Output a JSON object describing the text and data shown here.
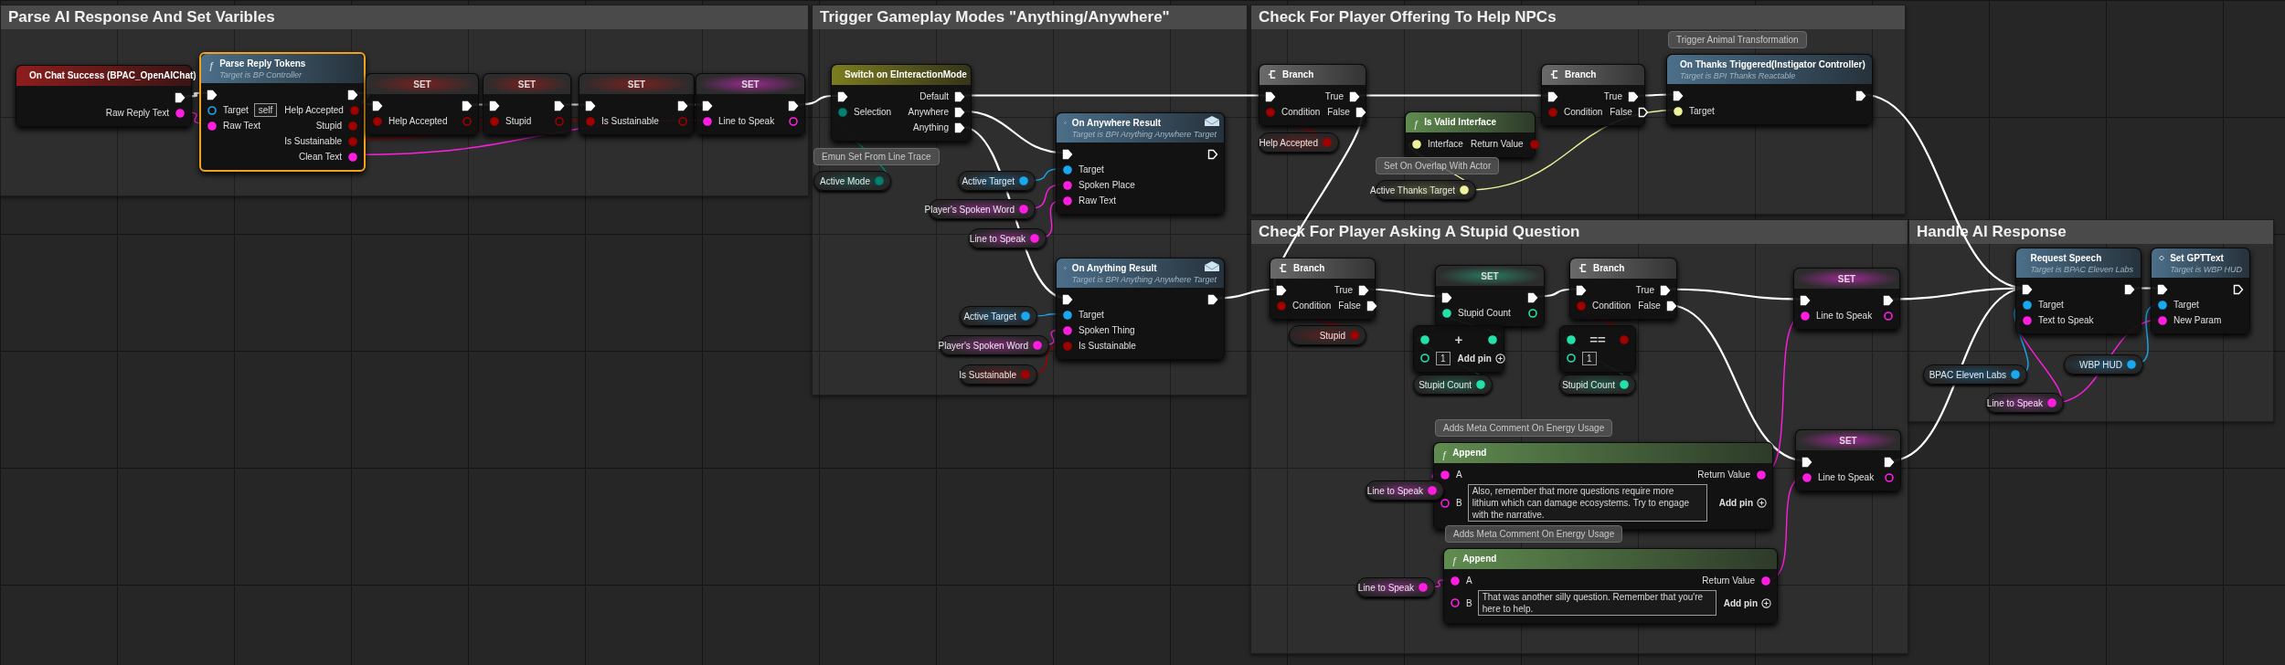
{
  "comments": [
    {
      "title": "Parse AI Response And Set Varibles"
    },
    {
      "title": "Trigger Gameplay Modes \"Anything/Anywhere\""
    },
    {
      "title": "Check For Player Offering To Help NPCs"
    },
    {
      "title": "Check For Player Asking A Stupid Question"
    },
    {
      "title": "Handle AI Response"
    }
  ],
  "nodes": [
    {
      "kind": "event",
      "title": "On Chat Success (BPAC_OpenAIChat)",
      "selected": false,
      "outputs": [
        {
          "kind": "exec",
          "linked": true
        },
        {
          "label": "Raw Reply Text",
          "kind": "string",
          "linked": true
        }
      ]
    },
    {
      "kind": "function",
      "glyph": "ƒ",
      "title": "Parse Reply Tokens",
      "subtitle": "Target is BP Controller",
      "selected": true,
      "inputs": [
        {
          "kind": "exec",
          "linked": true
        },
        {
          "label": "Target",
          "kind": "object",
          "linked": false,
          "value": "self"
        },
        {
          "label": "Raw Text",
          "kind": "string",
          "linked": true
        }
      ],
      "outputs": [
        {
          "kind": "exec",
          "linked": true
        },
        {
          "label": "Help Accepted",
          "kind": "bool",
          "linked": true
        },
        {
          "label": "Stupid",
          "kind": "bool",
          "linked": true
        },
        {
          "label": "Is Sustainable",
          "kind": "bool",
          "linked": true
        },
        {
          "label": "Clean Text",
          "kind": "string",
          "linked": true
        }
      ]
    },
    {
      "kind": "set",
      "title": "SET",
      "selected": false,
      "inputs": [
        {
          "kind": "exec",
          "linked": true
        },
        {
          "label": "Help Accepted",
          "kind": "bool",
          "linked": true
        }
      ],
      "outputs": [
        {
          "kind": "exec",
          "linked": true
        },
        {
          "kind": "bool",
          "linked": false
        }
      ]
    },
    {
      "kind": "set",
      "title": "SET",
      "selected": false,
      "inputs": [
        {
          "kind": "exec",
          "linked": true
        },
        {
          "label": "Stupid",
          "kind": "bool",
          "linked": true
        }
      ],
      "outputs": [
        {
          "kind": "exec",
          "linked": true
        },
        {
          "kind": "bool",
          "linked": false
        }
      ]
    },
    {
      "kind": "set",
      "title": "SET",
      "selected": false,
      "inputs": [
        {
          "kind": "exec",
          "linked": true
        },
        {
          "label": "Is Sustainable",
          "kind": "bool",
          "linked": true
        }
      ],
      "outputs": [
        {
          "kind": "exec",
          "linked": true
        },
        {
          "kind": "bool",
          "linked": false
        }
      ]
    },
    {
      "kind": "set",
      "title": "SET",
      "selected": false,
      "inputs": [
        {
          "kind": "exec",
          "linked": true
        },
        {
          "label": "Line to Speak",
          "kind": "string",
          "linked": true
        }
      ],
      "outputs": [
        {
          "kind": "exec",
          "linked": true
        },
        {
          "kind": "string",
          "linked": false
        }
      ]
    },
    {
      "kind": "switch",
      "title": "Switch on EInteractionMode",
      "selected": false,
      "inputs": [
        {
          "kind": "exec",
          "linked": true
        },
        {
          "label": "Selection",
          "kind": "enum",
          "linked": true
        }
      ],
      "outputs": [
        {
          "label": "Default",
          "kind": "exec",
          "linked": true
        },
        {
          "label": "Anywhere",
          "kind": "exec",
          "linked": true
        },
        {
          "label": "Anything",
          "kind": "exec",
          "linked": true
        }
      ]
    },
    {
      "kind": "variable",
      "title": "Active Mode",
      "note": "Emun Set From Line Trace",
      "selected": false,
      "outputs": [
        {
          "kind": "enum",
          "linked": true
        }
      ]
    },
    {
      "kind": "message",
      "title": "On Anywhere Result",
      "subtitle": "Target is BPI Anything Anywhere Target",
      "selected": false,
      "inputs": [
        {
          "kind": "exec",
          "linked": true
        },
        {
          "label": "Target",
          "kind": "object",
          "linked": true
        },
        {
          "label": "Spoken Place",
          "kind": "string",
          "linked": true
        },
        {
          "label": "Raw Text",
          "kind": "string",
          "linked": true
        }
      ],
      "outputs": [
        {
          "kind": "exec",
          "linked": false
        }
      ]
    },
    {
      "kind": "variable",
      "title": "Active Target",
      "selected": false,
      "outputs": [
        {
          "kind": "object",
          "linked": true
        }
      ]
    },
    {
      "kind": "variable",
      "title": "Player's Spoken Word",
      "selected": false,
      "outputs": [
        {
          "kind": "string",
          "linked": true
        }
      ]
    },
    {
      "kind": "variable",
      "title": "Line to Speak",
      "selected": false,
      "outputs": [
        {
          "kind": "string",
          "linked": true
        }
      ]
    },
    {
      "kind": "message",
      "title": "On Anything Result",
      "subtitle": "Target is BPI Anything Anywhere Target",
      "selected": false,
      "inputs": [
        {
          "kind": "exec",
          "linked": true
        },
        {
          "label": "Target",
          "kind": "object",
          "linked": true
        },
        {
          "label": "Spoken Thing",
          "kind": "string",
          "linked": true
        },
        {
          "label": "Is Sustainable",
          "kind": "bool",
          "linked": true
        }
      ],
      "outputs": [
        {
          "kind": "exec",
          "linked": true
        }
      ]
    },
    {
      "kind": "variable",
      "title": "Active Target",
      "selected": false,
      "outputs": [
        {
          "kind": "object",
          "linked": true
        }
      ]
    },
    {
      "kind": "variable",
      "title": "Player's Spoken Word",
      "selected": false,
      "outputs": [
        {
          "kind": "string",
          "linked": true
        }
      ]
    },
    {
      "kind": "variable",
      "title": "Is Sustainable",
      "selected": false,
      "outputs": [
        {
          "kind": "bool",
          "linked": true
        }
      ]
    },
    {
      "kind": "branch",
      "title": "Branch",
      "selected": false,
      "inputs": [
        {
          "kind": "exec",
          "linked": true
        },
        {
          "label": "Condition",
          "kind": "bool",
          "linked": true
        }
      ],
      "outputs": [
        {
          "label": "True",
          "kind": "exec",
          "linked": true
        },
        {
          "label": "False",
          "kind": "exec",
          "linked": true
        }
      ]
    },
    {
      "kind": "variable",
      "title": "Help Accepted",
      "selected": false,
      "outputs": [
        {
          "kind": "bool",
          "linked": true
        }
      ]
    },
    {
      "kind": "pure",
      "glyph": "ƒ",
      "title": "Is Valid Interface",
      "selected": false,
      "inputs": [
        {
          "label": "Interface",
          "kind": "interface",
          "linked": true
        }
      ],
      "outputs": [
        {
          "label": "Return Value",
          "kind": "bool",
          "linked": true
        }
      ]
    },
    {
      "kind": "variable",
      "title": "Active Thanks Target",
      "note": "Set On Overlap With Actor",
      "selected": false,
      "outputs": [
        {
          "kind": "interface",
          "linked": true
        }
      ]
    },
    {
      "kind": "branch",
      "title": "Branch",
      "selected": false,
      "inputs": [
        {
          "kind": "exec",
          "linked": true
        },
        {
          "label": "Condition",
          "kind": "bool",
          "linked": true
        }
      ],
      "outputs": [
        {
          "label": "True",
          "kind": "exec",
          "linked": true
        },
        {
          "label": "False",
          "kind": "exec",
          "linked": false
        }
      ]
    },
    {
      "kind": "call",
      "title": "On Thanks Triggered(Instigator Controller)",
      "subtitle": "Target is BPI Thanks Reactable",
      "note": "Trigger Animal Transformation",
      "selected": false,
      "inputs": [
        {
          "kind": "exec",
          "linked": true
        },
        {
          "label": "Target",
          "kind": "interface",
          "linked": true
        }
      ],
      "outputs": [
        {
          "kind": "exec",
          "linked": true
        }
      ]
    },
    {
      "kind": "branch",
      "title": "Branch",
      "selected": false,
      "inputs": [
        {
          "kind": "exec",
          "linked": true
        },
        {
          "label": "Condition",
          "kind": "bool",
          "linked": true
        }
      ],
      "outputs": [
        {
          "label": "True",
          "kind": "exec",
          "linked": true
        },
        {
          "label": "False",
          "kind": "exec",
          "linked": true
        }
      ]
    },
    {
      "kind": "variable",
      "title": "Stupid",
      "selected": false,
      "outputs": [
        {
          "kind": "bool",
          "linked": true
        }
      ]
    },
    {
      "kind": "set",
      "title": "SET",
      "selected": false,
      "inputs": [
        {
          "kind": "exec",
          "linked": true
        },
        {
          "label": "Stupid Count",
          "kind": "int",
          "linked": true
        }
      ],
      "outputs": [
        {
          "kind": "exec",
          "linked": true
        },
        {
          "kind": "int",
          "linked": false
        }
      ]
    },
    {
      "kind": "math",
      "op": "+",
      "add_pin": "Add pin",
      "selected": false,
      "inputs": [
        {
          "kind": "int",
          "linked": true
        },
        {
          "kind": "int",
          "linked": false,
          "value": "1"
        }
      ],
      "outputs": [
        {
          "kind": "int",
          "linked": true
        }
      ]
    },
    {
      "kind": "variable",
      "title": "Stupid Count",
      "selected": false,
      "outputs": [
        {
          "kind": "int",
          "linked": true
        }
      ]
    },
    {
      "kind": "branch",
      "title": "Branch",
      "selected": false,
      "inputs": [
        {
          "kind": "exec",
          "linked": true
        },
        {
          "label": "Condition",
          "kind": "bool",
          "linked": true
        }
      ],
      "outputs": [
        {
          "label": "True",
          "kind": "exec",
          "linked": true
        },
        {
          "label": "False",
          "kind": "exec",
          "linked": true
        }
      ]
    },
    {
      "kind": "math",
      "op": "==",
      "selected": false,
      "inputs": [
        {
          "kind": "int",
          "linked": true
        },
        {
          "kind": "int",
          "linked": false,
          "value": "1"
        }
      ],
      "outputs": [
        {
          "kind": "bool",
          "linked": true
        }
      ]
    },
    {
      "kind": "variable",
      "title": "Stupid Count",
      "selected": false,
      "outputs": [
        {
          "kind": "int",
          "linked": true
        }
      ]
    },
    {
      "kind": "pure",
      "glyph": "ƒ",
      "title": "Append",
      "note": "Adds Meta Comment On Energy Usage",
      "add_pin": "Add pin",
      "selected": false,
      "inputs": [
        {
          "label": "A",
          "kind": "string",
          "linked": true
        },
        {
          "label": "B",
          "kind": "string",
          "linked": false,
          "value": "Also, remember that more questions require more lithium which can damage ecosystems. Try to engage with the narrative."
        }
      ],
      "outputs": [
        {
          "label": "Return Value",
          "kind": "string",
          "linked": true
        }
      ]
    },
    {
      "kind": "variable",
      "title": "Line to Speak",
      "selected": false,
      "outputs": [
        {
          "kind": "string",
          "linked": true
        }
      ]
    },
    {
      "kind": "pure",
      "glyph": "ƒ",
      "title": "Append",
      "note": "Adds Meta Comment On Energy Usage",
      "add_pin": "Add pin",
      "selected": false,
      "inputs": [
        {
          "label": "A",
          "kind": "string",
          "linked": true
        },
        {
          "label": "B",
          "kind": "string",
          "linked": false,
          "value": "That was another silly question. Remember that you're here to help."
        }
      ],
      "outputs": [
        {
          "label": "Return Value",
          "kind": "string",
          "linked": true
        }
      ]
    },
    {
      "kind": "variable",
      "title": "Line to Speak",
      "selected": false,
      "outputs": [
        {
          "kind": "string",
          "linked": true
        }
      ]
    },
    {
      "kind": "set",
      "title": "SET",
      "selected": false,
      "inputs": [
        {
          "kind": "exec",
          "linked": true
        },
        {
          "label": "Line to Speak",
          "kind": "string",
          "linked": true
        }
      ],
      "outputs": [
        {
          "kind": "exec",
          "linked": true
        },
        {
          "kind": "string",
          "linked": false
        }
      ]
    },
    {
      "kind": "set",
      "title": "SET",
      "selected": false,
      "inputs": [
        {
          "kind": "exec",
          "linked": true
        },
        {
          "label": "Line to Speak",
          "kind": "string",
          "linked": true
        }
      ],
      "outputs": [
        {
          "kind": "exec",
          "linked": true
        },
        {
          "kind": "string",
          "linked": false
        }
      ]
    },
    {
      "kind": "call",
      "title": "Request Speech",
      "subtitle": "Target is BPAC Eleven Labs",
      "selected": false,
      "inputs": [
        {
          "kind": "exec",
          "linked": true
        },
        {
          "label": "Target",
          "kind": "object",
          "linked": true
        },
        {
          "label": "Text to Speak",
          "kind": "string",
          "linked": true
        }
      ],
      "outputs": [
        {
          "kind": "exec",
          "linked": true
        }
      ]
    },
    {
      "kind": "call",
      "title": "Set GPTText",
      "subtitle": "Target is WBP HUD",
      "selected": false,
      "inputs": [
        {
          "kind": "exec",
          "linked": true
        },
        {
          "label": "Target",
          "kind": "object",
          "linked": true
        },
        {
          "label": "New Param",
          "kind": "string",
          "linked": true
        }
      ],
      "outputs": [
        {
          "kind": "exec",
          "linked": false
        }
      ]
    },
    {
      "kind": "variable",
      "title": "BPAC Eleven Labs",
      "selected": false,
      "outputs": [
        {
          "kind": "object",
          "linked": true
        }
      ]
    },
    {
      "kind": "variable",
      "title": "WBP HUD",
      "selected": false,
      "outputs": [
        {
          "kind": "object",
          "linked": true
        }
      ]
    },
    {
      "kind": "variable",
      "title": "Line to Speak",
      "selected": false,
      "outputs": [
        {
          "kind": "string",
          "linked": true
        }
      ]
    }
  ]
}
